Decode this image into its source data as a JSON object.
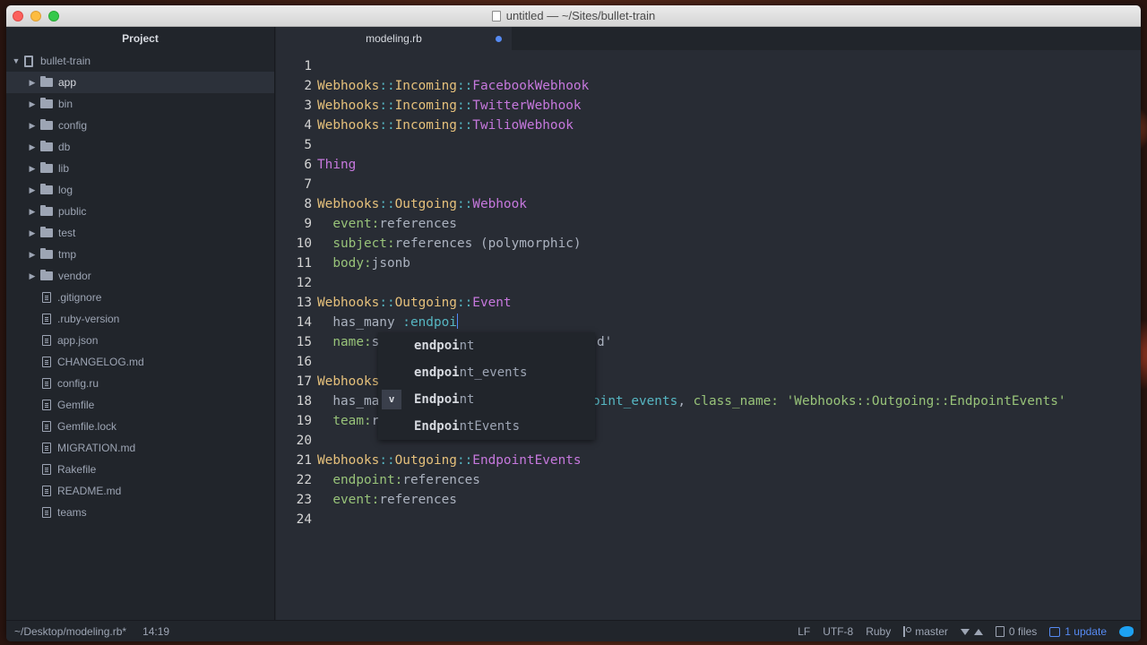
{
  "window": {
    "title": "untitled — ~/Sites/bullet-train"
  },
  "sidebar": {
    "header": "Project",
    "root": "bullet-train",
    "folders": [
      "app",
      "bin",
      "config",
      "db",
      "lib",
      "log",
      "public",
      "test",
      "tmp",
      "vendor"
    ],
    "selected": "app",
    "files": [
      ".gitignore",
      ".ruby-version",
      "app.json",
      "CHANGELOG.md",
      "config.ru",
      "Gemfile",
      "Gemfile.lock",
      "MIGRATION.md",
      "Rakefile",
      "README.md",
      "teams"
    ]
  },
  "tab": {
    "label": "modeling.rb",
    "modified": true
  },
  "code": {
    "lines": [
      "",
      "Webhooks::Incoming::FacebookWebhook",
      "Webhooks::Incoming::TwitterWebhook",
      "Webhooks::Incoming::TwilioWebhook",
      "",
      "Thing",
      "",
      "Webhooks::Outgoing::Webhook",
      "  event:references",
      "  subject:references (polymorphic)",
      "  body:jsonb",
      "",
      "Webhooks::Outgoing::Event",
      "  has_many :endpoi",
      "  name:s",
      "",
      "Webhooks",
      "  has_ma",
      "  team:r",
      "",
      "Webhooks::Outgoing::EndpointEvents",
      "  endpoint:references",
      "  event:references",
      ""
    ],
    "line14_tail_visible": "d'",
    "line18_tail_visible": "oint_events, class_name: 'Webhooks::Outgoing::EndpointEvents'"
  },
  "autocomplete": {
    "items": [
      {
        "typed": "endpoi",
        "rest": "nt",
        "type": ""
      },
      {
        "typed": "endpoi",
        "rest": "nt_events",
        "type": ""
      },
      {
        "typed": "Endpoi",
        "rest": "nt",
        "type": "v"
      },
      {
        "typed": "Endpoi",
        "rest": "ntEvents",
        "type": ""
      }
    ]
  },
  "status": {
    "file_path": "~/Desktop/modeling.rb*",
    "cursor": "14:19",
    "line_ending": "LF",
    "encoding": "UTF-8",
    "grammar": "Ruby",
    "branch": "master",
    "files": "0 files",
    "update": "1 update"
  }
}
